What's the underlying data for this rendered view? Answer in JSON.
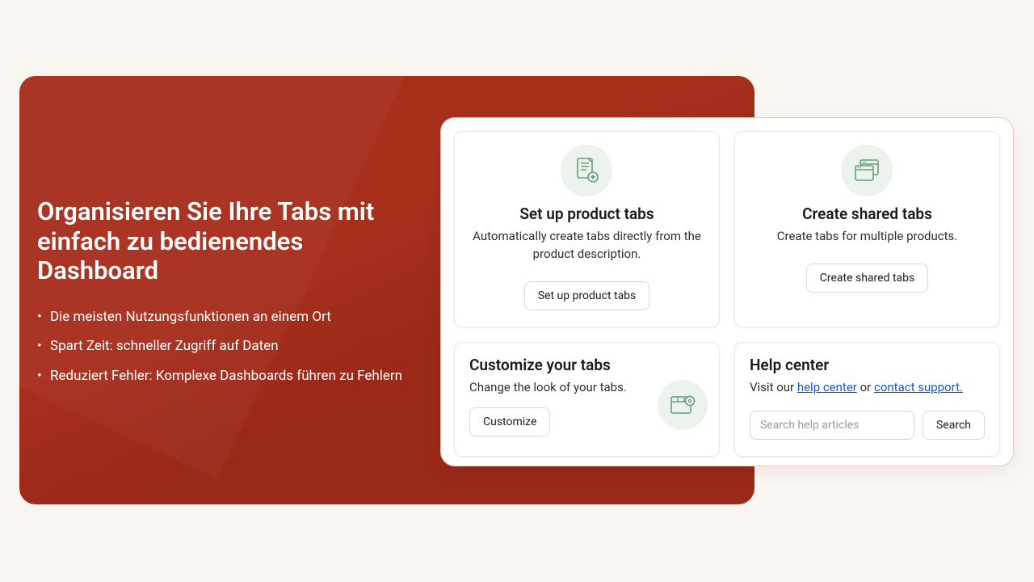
{
  "hero": {
    "title": "Organisieren Sie Ihre Tabs mit einfach zu bedienendes Dashboard",
    "bullets": [
      "Die meisten Nutzungsfunktionen an einem Ort",
      "Spart Zeit: schneller Zugriff auf Daten",
      "Reduziert Fehler: Komplexe Dashboards führen zu Fehlern"
    ]
  },
  "cards": {
    "setup": {
      "title": "Set up product tabs",
      "desc": "Automatically create tabs directly from the product description.",
      "button": "Set up product tabs",
      "icon": "document-plus-icon"
    },
    "shared": {
      "title": "Create shared tabs",
      "desc": "Create tabs for multiple products.",
      "button": "Create shared tabs",
      "icon": "windows-icon"
    },
    "customize": {
      "title": "Customize your tabs",
      "desc": "Change the look of your tabs.",
      "button": "Customize",
      "icon": "tab-gear-icon"
    },
    "help": {
      "title": "Help center",
      "desc_prefix": "Visit our ",
      "link1": "help center",
      "desc_mid": " or ",
      "link2": "contact support.",
      "search_placeholder": "Search help articles",
      "search_button": "Search"
    }
  },
  "colors": {
    "hero_bg": "#a92f1d",
    "icon_bg": "#ecf2ec",
    "icon_stroke": "#6a9e77",
    "link": "#1558d6"
  }
}
